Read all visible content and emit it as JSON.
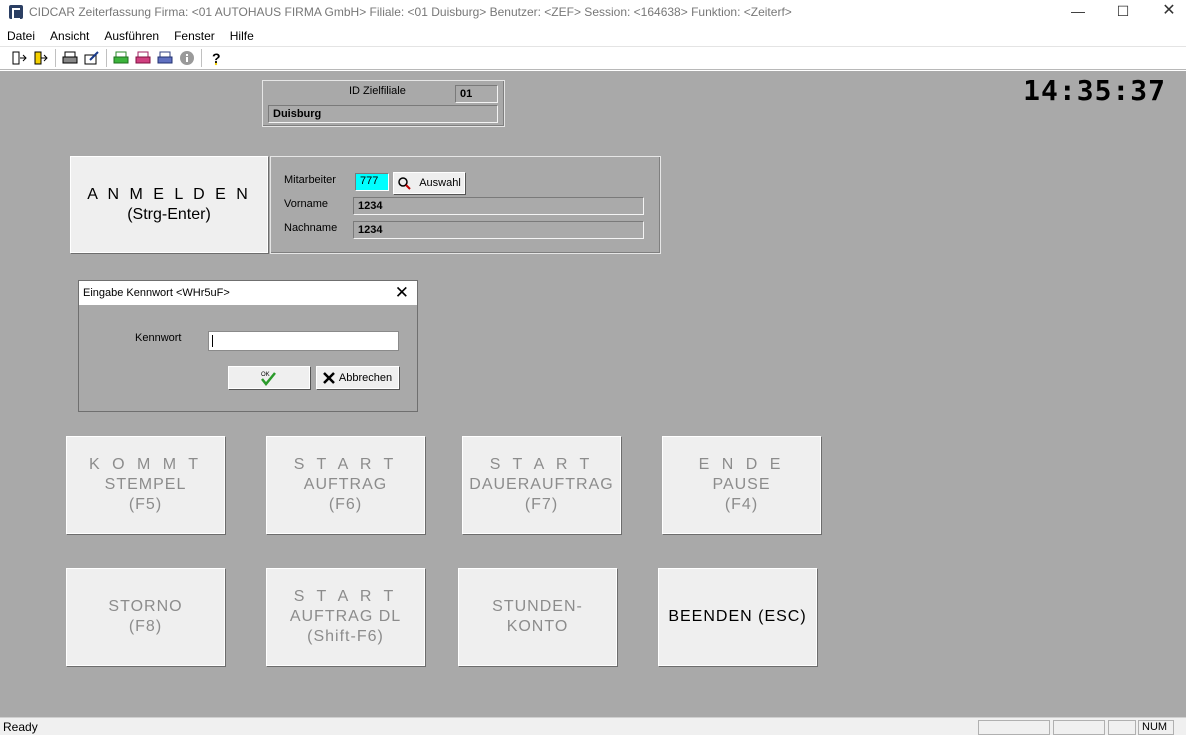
{
  "window": {
    "title": "CIDCAR Zeiterfassung  Firma: <01 AUTOHAUS FIRMA GmbH> Filiale: <01 Duisburg> Benutzer: <ZEF> Session: <164638> Funktion: <Zeiterf>",
    "minimize": "—",
    "maximize": "☐",
    "close": "✕"
  },
  "menu": [
    "Datei",
    "Ansicht",
    "Ausführen",
    "Fenster",
    "Hilfe"
  ],
  "toolbar_icons": [
    "login-icon",
    "logout-icon",
    "print-icon",
    "edit-icon",
    "print-green-icon",
    "print-red-icon",
    "print-blue-icon",
    "info-icon",
    "help-icon"
  ],
  "clock": "14:35:37",
  "filiale": {
    "label": "ID Zielfiliale",
    "id": "01",
    "name": "Duisburg"
  },
  "anmelden": {
    "line1": "A N M E L D E N",
    "line2": "(Strg-Enter)"
  },
  "mitarbeiter": {
    "label": "Mitarbeiter",
    "value": "777",
    "auswahl": "Auswahl",
    "vorname_label": "Vorname",
    "vorname": "1234",
    "nachname_label": "Nachname",
    "nachname": "1234",
    "highlight_color": "#00ffff"
  },
  "dialog": {
    "title": "Eingabe Kennwort   <WHr5uF>",
    "kennwort_label": "Kennwort",
    "kennwort_value": "",
    "ok_label": "OK",
    "cancel_label": "Abbrechen"
  },
  "buttons": {
    "kommt": [
      "K O M M T",
      "STEMPEL",
      "(F5)"
    ],
    "start_auftrag": [
      "S T A R T",
      "AUFTRAG",
      "(F6)"
    ],
    "start_dauer": [
      "S T A R T",
      "DAUERAUFTRAG",
      "(F7)"
    ],
    "ende_pause": [
      "E N D E",
      "PAUSE",
      "(F4)"
    ],
    "storno": [
      "STORNO",
      "(F8)"
    ],
    "start_dl": [
      "S T A R T",
      "AUFTRAG DL",
      "(Shift-F6)"
    ],
    "stundenkonto": [
      "STUNDEN-",
      "KONTO"
    ],
    "beenden": "BEENDEN (ESC)"
  },
  "status": {
    "ready": "Ready",
    "num": "NUM"
  }
}
